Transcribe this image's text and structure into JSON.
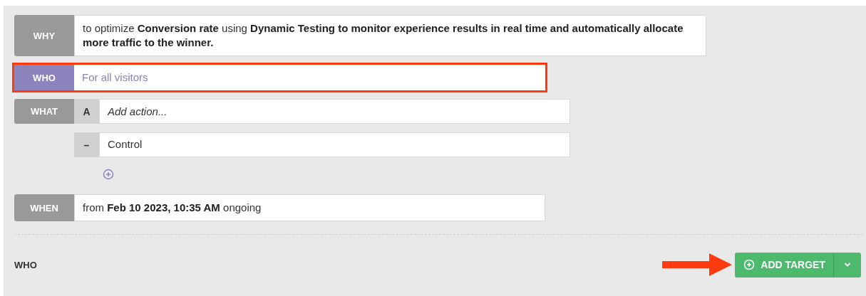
{
  "rules": [
    {
      "kind": "text",
      "label": "WHY",
      "text": "to optimize **Conversion rate** using **Dynamic Testing to monitor experience results in real time and automatically allocate more traffic to the winner.**"
    },
    {
      "kind": "text",
      "label": "WHO",
      "highlighted": true,
      "text": "For all visitors"
    },
    {
      "kind": "actions",
      "label": "WHAT",
      "actions": [
        {
          "tag": "A",
          "placeholder": "Add action..."
        },
        {
          "tag": "–",
          "value": "Control"
        }
      ]
    },
    {
      "kind": "text",
      "label": "WHEN",
      "text": "from **Feb 10 2023, 10:35 AM** ongoing"
    }
  ],
  "footer": {
    "section": "WHO",
    "button": "ADD TARGET",
    "callout_arrow": true
  }
}
